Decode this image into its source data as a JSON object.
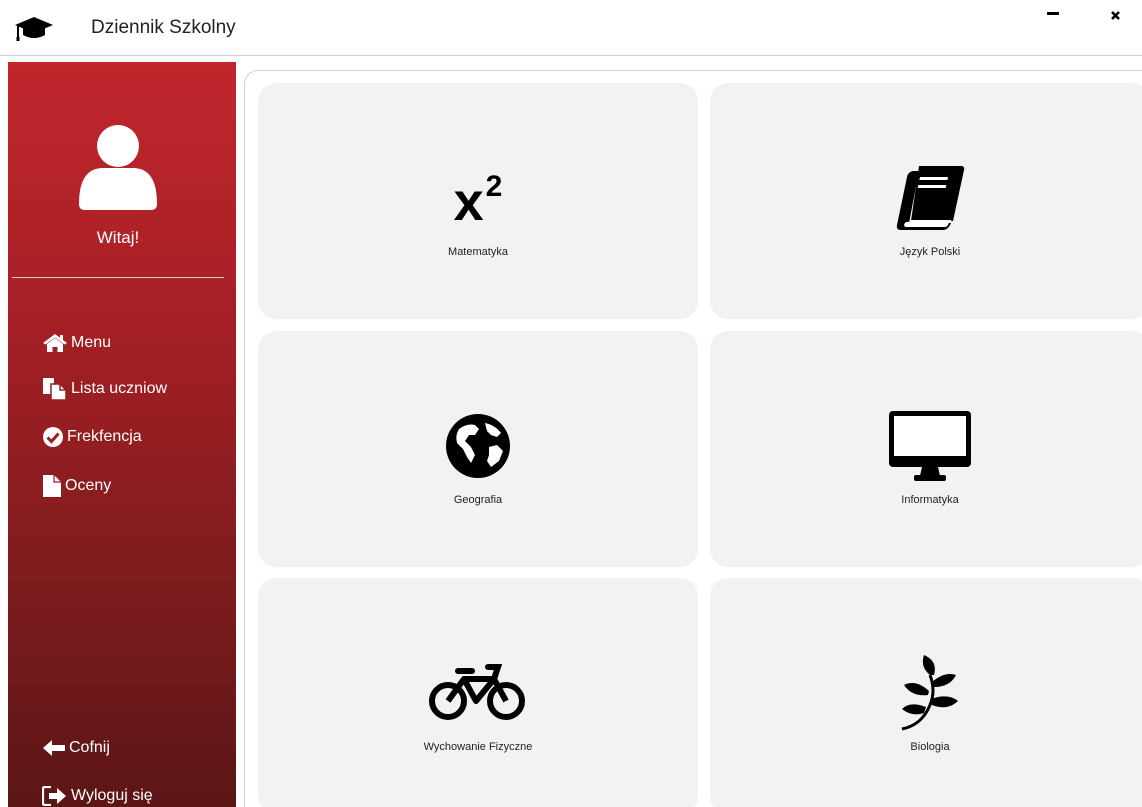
{
  "window": {
    "title": "Dziennik Szkolny",
    "icon": "graduation-cap-icon",
    "controls": [
      "minimize-icon",
      "close-icon"
    ]
  },
  "sidebar": {
    "welcome": "Witaj!",
    "avatar_icon": "user-icon",
    "items": [
      {
        "label": "Menu",
        "icon": "home-icon"
      },
      {
        "label": "Lista uczniow",
        "icon": "copy-icon"
      },
      {
        "label": "Frekfencja",
        "icon": "check-circle-icon"
      },
      {
        "label": "Oceny",
        "icon": "file-icon"
      }
    ],
    "bottom": [
      {
        "label": "Cofnij",
        "icon": "arrow-left-icon"
      },
      {
        "label": "Wyloguj się",
        "icon": "sign-out-icon"
      }
    ]
  },
  "subjects": [
    {
      "label": "Matematyka",
      "icon": "superscript-icon",
      "icon_text": "x",
      "icon_sup": "2"
    },
    {
      "label": "Język Polski",
      "icon": "book-icon"
    },
    {
      "label": "Geografia",
      "icon": "globe-icon"
    },
    {
      "label": "Informatyka",
      "icon": "desktop-icon"
    },
    {
      "label": "Wychowanie Fizyczne",
      "icon": "bicycle-icon"
    },
    {
      "label": "Biologia",
      "icon": "leaf-icon"
    }
  ],
  "colors": {
    "sidebar_top": "#c0272d",
    "sidebar_bottom": "#5b1515",
    "tile_bg": "#f2f2f2"
  }
}
